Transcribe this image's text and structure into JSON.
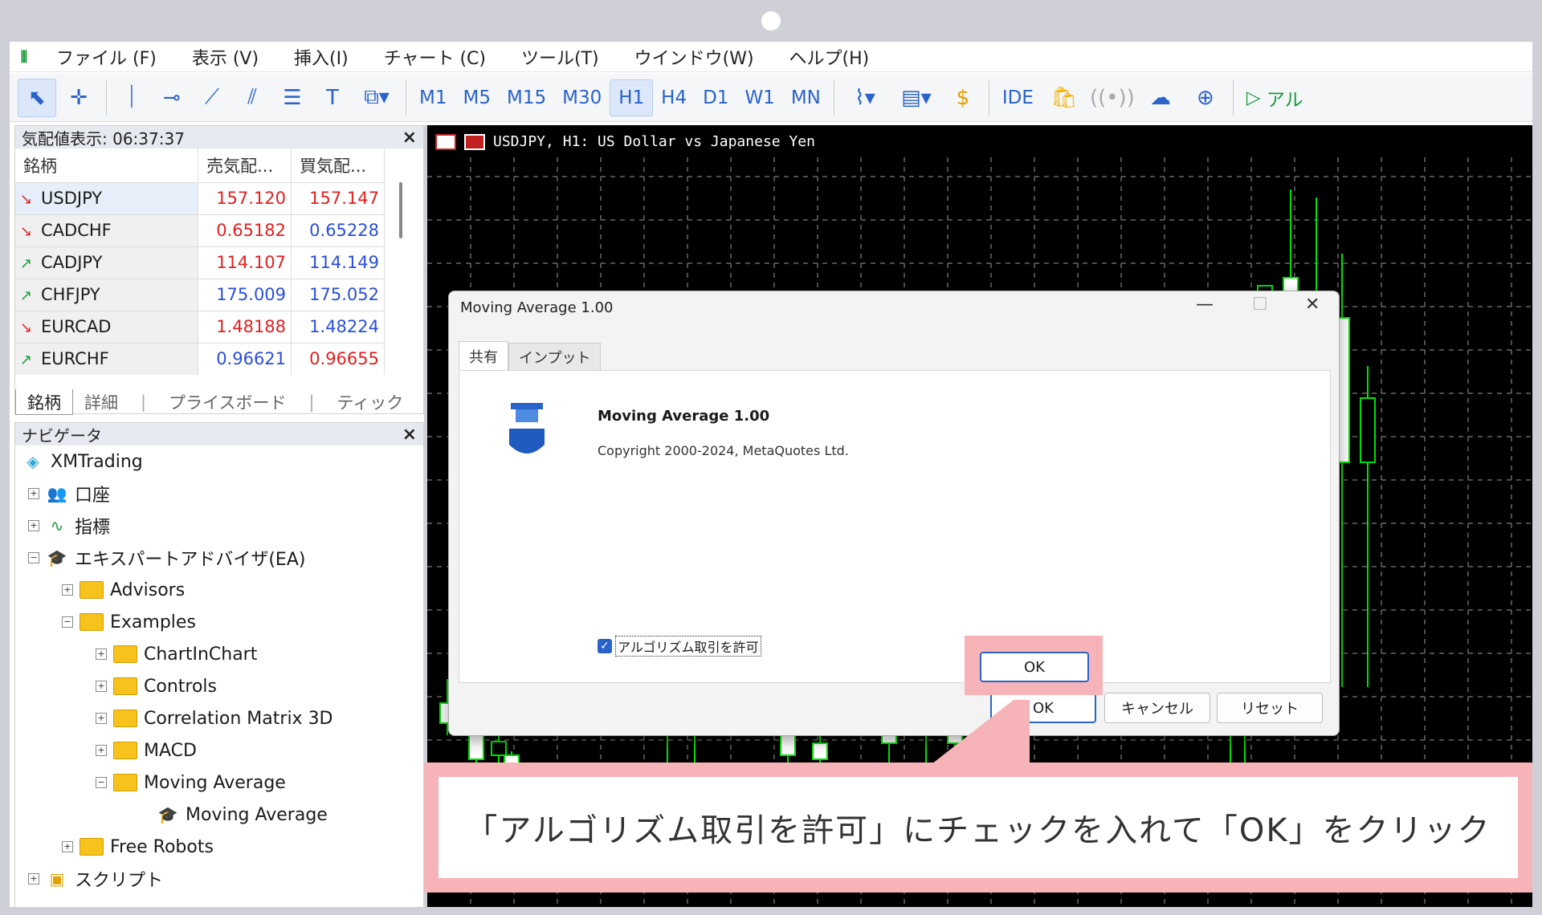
{
  "menu": {
    "items": [
      "ファイル (F)",
      "表示 (V)",
      "挿入(I)",
      "チャート (C)",
      "ツール(T)",
      "ウインドウ(W)",
      "ヘルプ(H)"
    ]
  },
  "toolbar": {
    "timeframes": [
      "M1",
      "M5",
      "M15",
      "M30",
      "H1",
      "H4",
      "D1",
      "W1",
      "MN"
    ],
    "selected_timeframe": "H1",
    "ide_label": "IDE",
    "algo_label": "アル"
  },
  "market_watch": {
    "title": "気配値表示: 06:37:37",
    "columns": [
      "銘柄",
      "売気配...",
      "買気配..."
    ],
    "rows": [
      {
        "symbol": "USDJPY",
        "dir": "down",
        "bid": "157.120",
        "ask": "157.147",
        "bid_color": "red",
        "ask_color": "red"
      },
      {
        "symbol": "CADCHF",
        "dir": "down",
        "bid": "0.65182",
        "ask": "0.65228",
        "bid_color": "red",
        "ask_color": "blue"
      },
      {
        "symbol": "CADJPY",
        "dir": "up",
        "bid": "114.107",
        "ask": "114.149",
        "bid_color": "red",
        "ask_color": "blue"
      },
      {
        "symbol": "CHFJPY",
        "dir": "up",
        "bid": "175.009",
        "ask": "175.052",
        "bid_color": "blue",
        "ask_color": "blue"
      },
      {
        "symbol": "EURCAD",
        "dir": "down",
        "bid": "1.48188",
        "ask": "1.48224",
        "bid_color": "red",
        "ask_color": "blue"
      },
      {
        "symbol": "EURCHF",
        "dir": "up",
        "bid": "0.96621",
        "ask": "0.96655",
        "bid_color": "blue",
        "ask_color": "red"
      }
    ],
    "tabs": [
      "銘柄",
      "詳細",
      "プライスボード",
      "ティック"
    ]
  },
  "navigator": {
    "title": "ナビゲータ",
    "root": "XMTrading",
    "items": {
      "accounts": "口座",
      "indicators": "指標",
      "experts": "エキスパートアドバイザ(EA)",
      "advisors": "Advisors",
      "examples": "Examples",
      "chartinchart": "ChartInChart",
      "controls": "Controls",
      "correlation": "Correlation Matrix 3D",
      "macd": "MACD",
      "moving_avg_folder": "Moving Average",
      "moving_avg_ea": "Moving Average",
      "free_robots": "Free Robots",
      "scripts": "スクリプト"
    }
  },
  "chart": {
    "title": "USDJPY, H1:  US Dollar vs Japanese Yen"
  },
  "dialog": {
    "title": "Moving Average 1.00",
    "tabs": [
      "共有",
      "インプット"
    ],
    "program_name": "Moving Average 1.00",
    "copyright": "Copyright 2000-2024, MetaQuotes Ltd.",
    "checkbox_label": "アルゴリズム取引を許可",
    "checkbox_checked": true,
    "buttons": {
      "ok": "OK",
      "cancel": "キャンセル",
      "reset": "リセット"
    }
  },
  "callout": {
    "text": "「アルゴリズム取引を許可」にチェックを入れて「OK」をクリック"
  },
  "colors": {
    "accent": "#2a63c9",
    "highlight": "#f7b4b8",
    "bullish": "#00e000"
  }
}
